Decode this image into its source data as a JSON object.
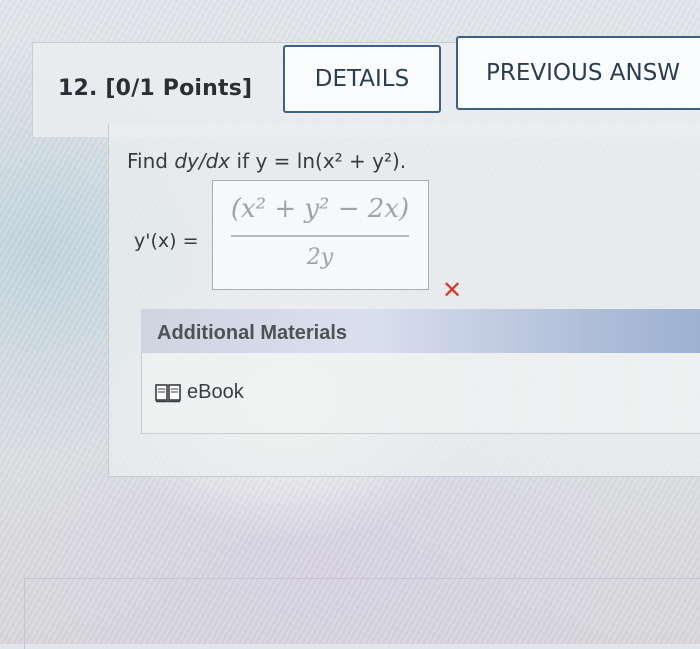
{
  "question": {
    "number_label": "12. [0/1 Points]"
  },
  "buttons": {
    "details_label": "DETAILS",
    "previous_answers_label": "PREVIOUS ANSW"
  },
  "prompt": {
    "find": "Find",
    "derivative": "dy/dx",
    "if": "if",
    "equation": "y = ln(x² + y²)."
  },
  "answer": {
    "label": "y'(x) =",
    "numerator": "(x² + y² − 2x)",
    "denominator": "2y",
    "status_mark": "✕"
  },
  "materials": {
    "header": "Additional Materials",
    "ebook_label": "eBook",
    "ebook_icon": "book-icon"
  },
  "colors": {
    "accent_border": "#3f5f86",
    "wrong": "#e0352c",
    "materials_bar": "#9cb0d2"
  }
}
